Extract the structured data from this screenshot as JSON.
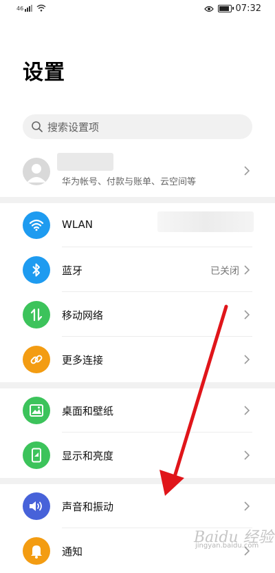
{
  "status_bar": {
    "signal_text": "46",
    "time": "07:32"
  },
  "page": {
    "title": "设置"
  },
  "search": {
    "placeholder": "搜索设置项"
  },
  "account": {
    "subtitle": "华为帐号、付款与账单、云空间等"
  },
  "items": [
    {
      "label": "WLAN",
      "value": "",
      "icon": "wifi-icon",
      "color": "#1e9bf0"
    },
    {
      "label": "蓝牙",
      "value": "已关闭",
      "icon": "bluetooth-icon",
      "color": "#1e9bf0"
    },
    {
      "label": "移动网络",
      "value": "",
      "icon": "mobile-data-icon",
      "color": "#3cc35b"
    },
    {
      "label": "更多连接",
      "value": "",
      "icon": "link-icon",
      "color": "#f39c12"
    },
    {
      "label": "桌面和壁纸",
      "value": "",
      "icon": "wallpaper-icon",
      "color": "#3cc35b"
    },
    {
      "label": "显示和亮度",
      "value": "",
      "icon": "display-icon",
      "color": "#3cc35b"
    },
    {
      "label": "声音和振动",
      "value": "",
      "icon": "sound-icon",
      "color": "#4762d9"
    },
    {
      "label": "通知",
      "value": "",
      "icon": "notification-icon",
      "color": "#f39c12"
    }
  ],
  "watermark": {
    "brand": "Baidu 经验",
    "url": "jingyan.baidu.com"
  },
  "colors": {
    "annotation_arrow": "#e0151a",
    "separator": "#f1f1f1"
  }
}
